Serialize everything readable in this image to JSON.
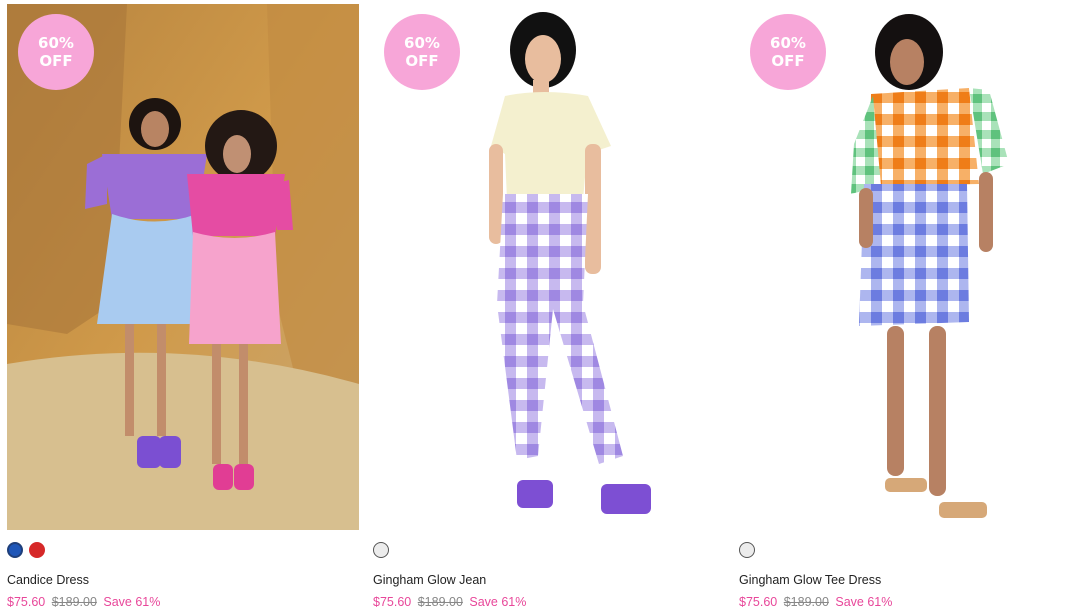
{
  "products": [
    {
      "badge_top": "60%",
      "badge_bottom": "OFF",
      "title": "Candice Dress",
      "sale_price": "$75.60",
      "original_price": "$189.00",
      "save_text": "Save 61%",
      "swatches": [
        "#1e56b8",
        "#d62828"
      ],
      "image": "two-models-candice-dress-sandstone"
    },
    {
      "badge_top": "60%",
      "badge_bottom": "OFF",
      "title": "Gingham Glow Jean",
      "sale_price": "$75.60",
      "original_price": "$189.00",
      "save_text": "Save 61%",
      "swatches": [
        "#ececec"
      ],
      "image": "model-gingham-jean-white"
    },
    {
      "badge_top": "60%",
      "badge_bottom": "OFF",
      "title": "Gingham Glow Tee Dress",
      "sale_price": "$75.60",
      "original_price": "$189.00",
      "save_text": "Save 61%",
      "swatches": [
        "#ececec"
      ],
      "image": "model-gingham-tee-dress-white"
    }
  ],
  "colors": {
    "badge": "#f7a6d8",
    "sale": "#e8479a",
    "original": "#888888"
  }
}
